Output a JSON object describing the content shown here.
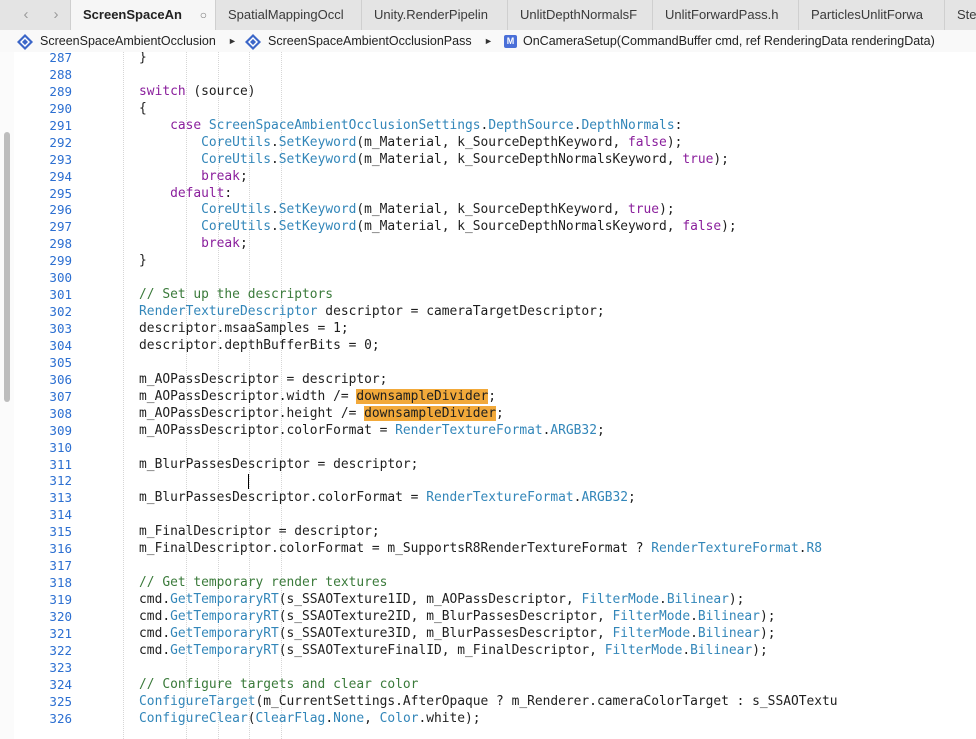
{
  "tabs": [
    {
      "label": "ScreenSpaceAn",
      "active": true,
      "close": "○"
    },
    {
      "label": "SpatialMappingOccl",
      "active": false
    },
    {
      "label": "Unity.RenderPipelin",
      "active": false
    },
    {
      "label": "UnlitDepthNormalsF",
      "active": false
    },
    {
      "label": "UnlitForwardPass.h",
      "active": false
    },
    {
      "label": "ParticlesUnlitForwa",
      "active": false
    },
    {
      "label": "Ste",
      "active": false
    }
  ],
  "nav": {
    "back": "‹",
    "forward": "›"
  },
  "breadcrumb": [
    {
      "label": "ScreenSpaceAmbientOcclusion",
      "icon": "csharp-class-icon"
    },
    {
      "label": "ScreenSpaceAmbientOcclusionPass",
      "icon": "csharp-class-icon"
    },
    {
      "label": "OnCameraSetup(CommandBuffer cmd, ref RenderingData renderingData)",
      "icon": "method-icon"
    }
  ],
  "breadcrumb_sep": "►",
  "method_icon_letter": "M",
  "colors": {
    "keyword": "#8a1e9c",
    "type": "#3286b9",
    "comment": "#3a7a3a",
    "line_number": "#2c6fd1",
    "highlight": "#f2a93a"
  },
  "code": {
    "lines": [
      {
        "n": "287",
        "segs": [
          {
            "t": "    }"
          }
        ]
      },
      {
        "n": "288",
        "segs": []
      },
      {
        "n": "289",
        "segs": [
          {
            "t": "    "
          },
          {
            "t": "switch",
            "c": "kw"
          },
          {
            "t": " (source)"
          }
        ]
      },
      {
        "n": "290",
        "segs": [
          {
            "t": "    {"
          }
        ]
      },
      {
        "n": "291",
        "segs": [
          {
            "t": "        "
          },
          {
            "t": "case",
            "c": "kw"
          },
          {
            "t": " "
          },
          {
            "t": "ScreenSpaceAmbientOcclusionSettings",
            "c": "ty"
          },
          {
            "t": "."
          },
          {
            "t": "DepthSource",
            "c": "ty"
          },
          {
            "t": "."
          },
          {
            "t": "DepthNormals",
            "c": "ty"
          },
          {
            "t": ":"
          }
        ]
      },
      {
        "n": "292",
        "segs": [
          {
            "t": "            "
          },
          {
            "t": "CoreUtils",
            "c": "ty"
          },
          {
            "t": "."
          },
          {
            "t": "SetKeyword",
            "c": "ty"
          },
          {
            "t": "(m_Material, k_SourceDepthKeyword, "
          },
          {
            "t": "false",
            "c": "kw"
          },
          {
            "t": ");"
          }
        ]
      },
      {
        "n": "293",
        "segs": [
          {
            "t": "            "
          },
          {
            "t": "CoreUtils",
            "c": "ty"
          },
          {
            "t": "."
          },
          {
            "t": "SetKeyword",
            "c": "ty"
          },
          {
            "t": "(m_Material, k_SourceDepthNormalsKeyword, "
          },
          {
            "t": "true",
            "c": "kw"
          },
          {
            "t": ");"
          }
        ]
      },
      {
        "n": "294",
        "segs": [
          {
            "t": "            "
          },
          {
            "t": "break",
            "c": "kw"
          },
          {
            "t": ";"
          }
        ]
      },
      {
        "n": "295",
        "segs": [
          {
            "t": "        "
          },
          {
            "t": "default",
            "c": "kw"
          },
          {
            "t": ":"
          }
        ]
      },
      {
        "n": "296",
        "segs": [
          {
            "t": "            "
          },
          {
            "t": "CoreUtils",
            "c": "ty"
          },
          {
            "t": "."
          },
          {
            "t": "SetKeyword",
            "c": "ty"
          },
          {
            "t": "(m_Material, k_SourceDepthKeyword, "
          },
          {
            "t": "true",
            "c": "kw"
          },
          {
            "t": ");"
          }
        ]
      },
      {
        "n": "297",
        "segs": [
          {
            "t": "            "
          },
          {
            "t": "CoreUtils",
            "c": "ty"
          },
          {
            "t": "."
          },
          {
            "t": "SetKeyword",
            "c": "ty"
          },
          {
            "t": "(m_Material, k_SourceDepthNormalsKeyword, "
          },
          {
            "t": "false",
            "c": "kw"
          },
          {
            "t": ");"
          }
        ]
      },
      {
        "n": "298",
        "segs": [
          {
            "t": "            "
          },
          {
            "t": "break",
            "c": "kw"
          },
          {
            "t": ";"
          }
        ]
      },
      {
        "n": "299",
        "segs": [
          {
            "t": "    }"
          }
        ]
      },
      {
        "n": "300",
        "segs": []
      },
      {
        "n": "301",
        "segs": [
          {
            "t": "    "
          },
          {
            "t": "// Set up the descriptors",
            "c": "cm"
          }
        ]
      },
      {
        "n": "302",
        "segs": [
          {
            "t": "    "
          },
          {
            "t": "RenderTextureDescriptor",
            "c": "ty"
          },
          {
            "t": " descriptor = cameraTargetDescriptor;"
          }
        ]
      },
      {
        "n": "303",
        "segs": [
          {
            "t": "    descriptor.msaaSamples = 1;"
          }
        ]
      },
      {
        "n": "304",
        "segs": [
          {
            "t": "    descriptor.depthBufferBits = 0;"
          }
        ]
      },
      {
        "n": "305",
        "segs": []
      },
      {
        "n": "306",
        "segs": [
          {
            "t": "    m_AOPassDescriptor = descriptor;"
          }
        ]
      },
      {
        "n": "307",
        "segs": [
          {
            "t": "    m_AOPassDescriptor.width /= "
          },
          {
            "t": "downsampleDivider",
            "c": "hl"
          },
          {
            "t": ";"
          }
        ]
      },
      {
        "n": "308",
        "segs": [
          {
            "t": "    m_AOPassDescriptor.height /= "
          },
          {
            "t": "downsampleDivider",
            "c": "hl"
          },
          {
            "t": ";"
          }
        ]
      },
      {
        "n": "309",
        "segs": [
          {
            "t": "    m_AOPassDescriptor.colorFormat = "
          },
          {
            "t": "RenderTextureFormat",
            "c": "ty"
          },
          {
            "t": "."
          },
          {
            "t": "ARGB32",
            "c": "ty"
          },
          {
            "t": ";"
          }
        ]
      },
      {
        "n": "310",
        "segs": []
      },
      {
        "n": "311",
        "segs": [
          {
            "t": "    m_BlurPassesDescriptor = descriptor;"
          }
        ]
      },
      {
        "n": "312",
        "segs": [],
        "caret": true
      },
      {
        "n": "313",
        "segs": [
          {
            "t": "    m_BlurPassesDescriptor.colorFormat = "
          },
          {
            "t": "RenderTextureFormat",
            "c": "ty"
          },
          {
            "t": "."
          },
          {
            "t": "ARGB32",
            "c": "ty"
          },
          {
            "t": ";"
          }
        ]
      },
      {
        "n": "314",
        "segs": []
      },
      {
        "n": "315",
        "segs": [
          {
            "t": "    m_FinalDescriptor = descriptor;"
          }
        ]
      },
      {
        "n": "316",
        "segs": [
          {
            "t": "    m_FinalDescriptor.colorFormat = m_SupportsR8RenderTextureFormat ? "
          },
          {
            "t": "RenderTextureFormat",
            "c": "ty"
          },
          {
            "t": "."
          },
          {
            "t": "R8",
            "c": "ty"
          }
        ]
      },
      {
        "n": "317",
        "segs": []
      },
      {
        "n": "318",
        "segs": [
          {
            "t": "    "
          },
          {
            "t": "// Get temporary render textures",
            "c": "cm"
          }
        ]
      },
      {
        "n": "319",
        "segs": [
          {
            "t": "    cmd."
          },
          {
            "t": "GetTemporaryRT",
            "c": "ty"
          },
          {
            "t": "(s_SSAOTexture1ID, m_AOPassDescriptor, "
          },
          {
            "t": "FilterMode",
            "c": "ty"
          },
          {
            "t": "."
          },
          {
            "t": "Bilinear",
            "c": "ty"
          },
          {
            "t": ");"
          }
        ]
      },
      {
        "n": "320",
        "segs": [
          {
            "t": "    cmd."
          },
          {
            "t": "GetTemporaryRT",
            "c": "ty"
          },
          {
            "t": "(s_SSAOTexture2ID, m_BlurPassesDescriptor, "
          },
          {
            "t": "FilterMode",
            "c": "ty"
          },
          {
            "t": "."
          },
          {
            "t": "Bilinear",
            "c": "ty"
          },
          {
            "t": ");"
          }
        ]
      },
      {
        "n": "321",
        "segs": [
          {
            "t": "    cmd."
          },
          {
            "t": "GetTemporaryRT",
            "c": "ty"
          },
          {
            "t": "(s_SSAOTexture3ID, m_BlurPassesDescriptor, "
          },
          {
            "t": "FilterMode",
            "c": "ty"
          },
          {
            "t": "."
          },
          {
            "t": "Bilinear",
            "c": "ty"
          },
          {
            "t": ");"
          }
        ]
      },
      {
        "n": "322",
        "segs": [
          {
            "t": "    cmd."
          },
          {
            "t": "GetTemporaryRT",
            "c": "ty"
          },
          {
            "t": "(s_SSAOTextureFinalID, m_FinalDescriptor, "
          },
          {
            "t": "FilterMode",
            "c": "ty"
          },
          {
            "t": "."
          },
          {
            "t": "Bilinear",
            "c": "ty"
          },
          {
            "t": ");"
          }
        ]
      },
      {
        "n": "323",
        "segs": []
      },
      {
        "n": "324",
        "segs": [
          {
            "t": "    "
          },
          {
            "t": "// Configure targets and clear color",
            "c": "cm"
          }
        ]
      },
      {
        "n": "325",
        "segs": [
          {
            "t": "    "
          },
          {
            "t": "ConfigureTarget",
            "c": "ty"
          },
          {
            "t": "(m_CurrentSettings.AfterOpaque ? m_Renderer.cameraColorTarget : s_SSAOTextu"
          }
        ]
      },
      {
        "n": "326",
        "segs": [
          {
            "t": "    "
          },
          {
            "t": "ConfigureClear",
            "c": "ty"
          },
          {
            "t": "("
          },
          {
            "t": "ClearFlag",
            "c": "ty"
          },
          {
            "t": "."
          },
          {
            "t": "None",
            "c": "ty"
          },
          {
            "t": ", "
          },
          {
            "t": "Color",
            "c": "ty"
          },
          {
            "t": ".white);"
          }
        ]
      }
    ]
  }
}
